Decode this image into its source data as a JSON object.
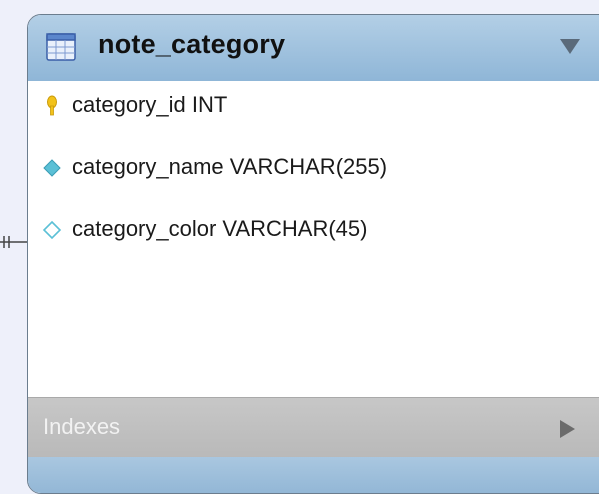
{
  "entity": {
    "title": "note_category",
    "header_color": "#9fc2de",
    "columns": [
      {
        "icon": "primary-key-icon",
        "label": "category_id INT"
      },
      {
        "icon": "filled-diamond-icon",
        "label": "category_name VARCHAR(255)"
      },
      {
        "icon": "hollow-diamond-icon",
        "label": "category_color VARCHAR(45)"
      }
    ],
    "indexes_label": "Indexes"
  },
  "colors": {
    "background": "#eef0fa",
    "key": "#f2c21a",
    "diamond": "#5bc0d6"
  }
}
